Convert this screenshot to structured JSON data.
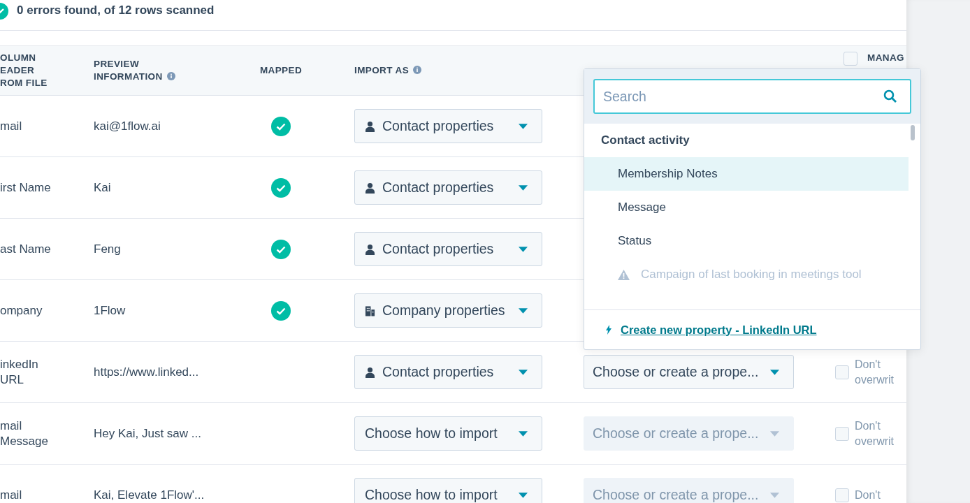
{
  "summary": {
    "text": "0 errors found, of 12 rows scanned"
  },
  "columns": [
    {
      "label": "OLUMN EADER ROM FILE"
    },
    {
      "label": "PREVIEW INFORMATION",
      "info": true
    },
    {
      "label": "MAPPED"
    },
    {
      "label": "IMPORT AS",
      "info": true
    },
    {
      "label": "MANAG",
      "checked": false
    }
  ],
  "rows": [
    {
      "header": "mail",
      "preview": "kai@1flow.ai",
      "mapped": true,
      "import": {
        "kind": "contact",
        "label": "Contact properties"
      }
    },
    {
      "header": "irst Name",
      "preview": "Kai",
      "mapped": true,
      "import": {
        "kind": "contact",
        "label": "Contact properties"
      }
    },
    {
      "header": "ast Name",
      "preview": "Feng",
      "mapped": true,
      "import": {
        "kind": "contact",
        "label": "Contact properties"
      }
    },
    {
      "header": "ompany",
      "preview": "1Flow",
      "mapped": true,
      "import": {
        "kind": "company",
        "label": "Company properties"
      }
    },
    {
      "header": "inkedIn URL",
      "preview": "https://www.linked...",
      "mapped": false,
      "import": {
        "kind": "contact",
        "label": "Contact properties"
      },
      "property": {
        "label": "Choose or create a prope...",
        "disabled": false
      },
      "overwrite": {
        "label": "Don't overwrit",
        "checked": false
      }
    },
    {
      "header": "mail Message",
      "preview": "Hey Kai, Just saw ...",
      "mapped": false,
      "import": {
        "kind": "none",
        "label": "Choose how to import"
      },
      "property": {
        "label": "Choose or create a prope...",
        "disabled": true
      },
      "overwrite": {
        "label": "Don't overwrit",
        "checked": false
      }
    },
    {
      "header": "mail",
      "preview": "Kai, Elevate 1Flow'...",
      "mapped": false,
      "import": {
        "kind": "none",
        "label": "Choose how to import"
      },
      "property": {
        "label": "Choose or create a prope...",
        "disabled": true
      },
      "overwrite": {
        "label": "Don't",
        "checked": false
      }
    }
  ],
  "dropdown": {
    "search": {
      "placeholder": "Search"
    },
    "group": "Contact activity",
    "options": [
      {
        "label": "Membership Notes",
        "selected": true,
        "disabled": false
      },
      {
        "label": "Message",
        "selected": false,
        "disabled": false
      },
      {
        "label": "Status",
        "selected": false,
        "disabled": false
      },
      {
        "label": "Campaign of last booking in meetings tool",
        "selected": false,
        "disabled": true
      }
    ],
    "create_link": "Create new property - LinkedIn URL"
  }
}
